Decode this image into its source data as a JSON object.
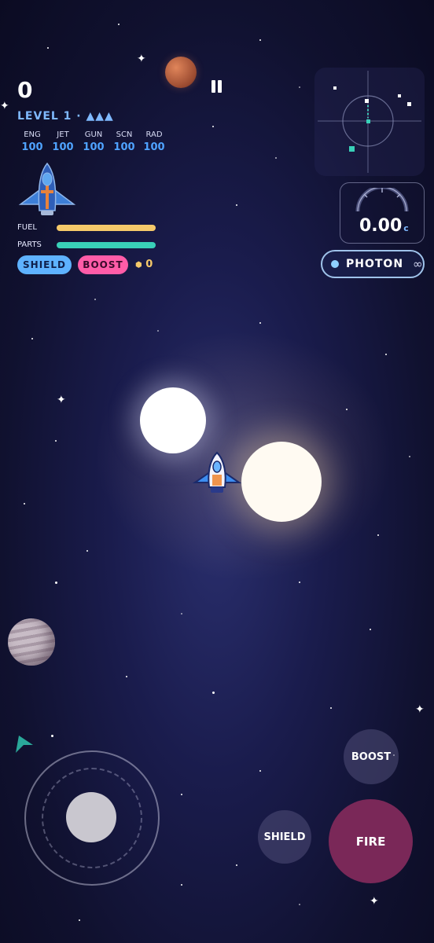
{
  "hud": {
    "score": "0",
    "level": "LEVEL 1 · ▲▲▲",
    "stats": [
      {
        "key": "ENG",
        "value": "100"
      },
      {
        "key": "JET",
        "value": "100"
      },
      {
        "key": "GUN",
        "value": "100"
      },
      {
        "key": "SCN",
        "value": "100"
      },
      {
        "key": "RAD",
        "value": "100"
      }
    ],
    "fuel_label": "FUEL",
    "fuel_level": 1.0,
    "parts_label": "PARTS",
    "parts_level": 1.0,
    "shield_pill": "SHIELD",
    "boost_pill": "BOOST",
    "coins": "0",
    "coin_icon": "⬢"
  },
  "speed": {
    "value": "0.00",
    "unit": "c"
  },
  "weapon": {
    "name": "PHOTON",
    "ammo": "∞"
  },
  "controls": {
    "boost_button": "BOOST",
    "shield_button": "SHIELD",
    "fire_button": "FIRE",
    "pause_icon": "pause-icon"
  },
  "colors": {
    "fuel_bar": "#f5c96a",
    "parts_bar": "#39d0b8",
    "shield_pill": "#5eb2ff",
    "boost_pill": "#ff5ca8",
    "fire_button": "#8a2a5a",
    "accent_blue": "#7fb9ff"
  }
}
